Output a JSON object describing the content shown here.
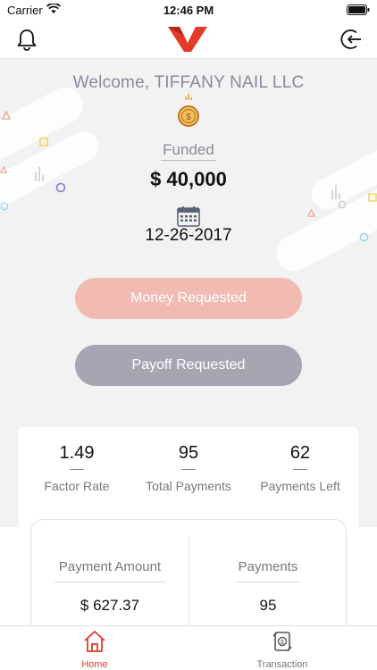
{
  "status_bar": {
    "carrier": "Carrier",
    "time": "12:46 PM"
  },
  "header": {
    "bell_icon": "bell-icon",
    "logout_icon": "logout-icon",
    "logo": "v-logo"
  },
  "welcome": {
    "text": "Welcome, TIFFANY NAIL LLC"
  },
  "funding": {
    "label": "Funded",
    "amount": "$ 40,000",
    "date": "12-26-2017"
  },
  "buttons": {
    "money_requested": "Money Requested",
    "payoff_requested": "Payoff Requested"
  },
  "stats": [
    {
      "value": "1.49",
      "label": "Factor Rate"
    },
    {
      "value": "95",
      "label": "Total Payments"
    },
    {
      "value": "62",
      "label": "Payments Left"
    }
  ],
  "payment_summary": {
    "payment_amount_label": "Payment Amount",
    "payment_amount_value": "$ 627.37",
    "payments_label": "Payments",
    "payments_value": "95"
  },
  "tabs": [
    {
      "label": "Home",
      "icon": "home-icon",
      "active": true
    },
    {
      "label": "Transaction",
      "icon": "transaction-icon",
      "active": false
    }
  ],
  "colors": {
    "accent": "#e33a2a",
    "money_button": "#f2bbb2",
    "payoff_button": "#a6a6b3"
  }
}
